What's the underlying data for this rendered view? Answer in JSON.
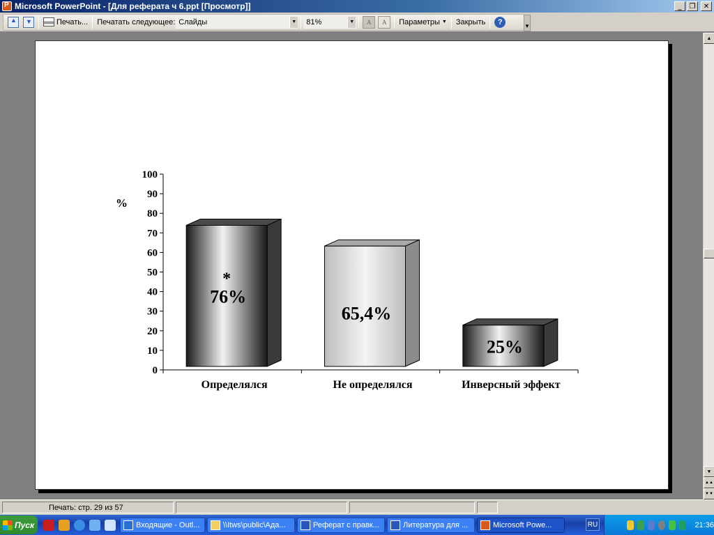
{
  "window": {
    "title": "Microsoft PowerPoint - [Для реферата ч 6.ppt [Просмотр]]"
  },
  "toolbar": {
    "print_label": "Печать...",
    "print_what_label": "Печатать следующее:",
    "print_what_value": "Слайды",
    "zoom_value": "81%",
    "options_label": "Параметры",
    "close_label": "Закрыть"
  },
  "status": {
    "page_info": "Печать: стр. 29 из 57"
  },
  "chart_data": {
    "type": "bar",
    "categories": [
      "Определялся",
      "Не определялся",
      "Инверсный эффект"
    ],
    "values": [
      76,
      65.4,
      25
    ],
    "data_labels": [
      "76%",
      "65,4%",
      "25%"
    ],
    "annotations": [
      "*"
    ],
    "ylabel": "%",
    "ylim": [
      0,
      100
    ],
    "yticks": [
      0,
      10,
      20,
      30,
      40,
      50,
      60,
      70,
      80,
      90,
      100
    ],
    "grid": false,
    "style": "3d-cylinder-bars"
  },
  "taskbar": {
    "start_label": "Пуск",
    "tasks": [
      {
        "label": "Входящие - Outl..."
      },
      {
        "label": "\\\\Itws\\public\\Ада..."
      },
      {
        "label": "Реферат с правк..."
      },
      {
        "label": "Литература для ..."
      },
      {
        "label": "Microsoft Powe..."
      }
    ],
    "language": "RU",
    "clock": "21:36"
  }
}
